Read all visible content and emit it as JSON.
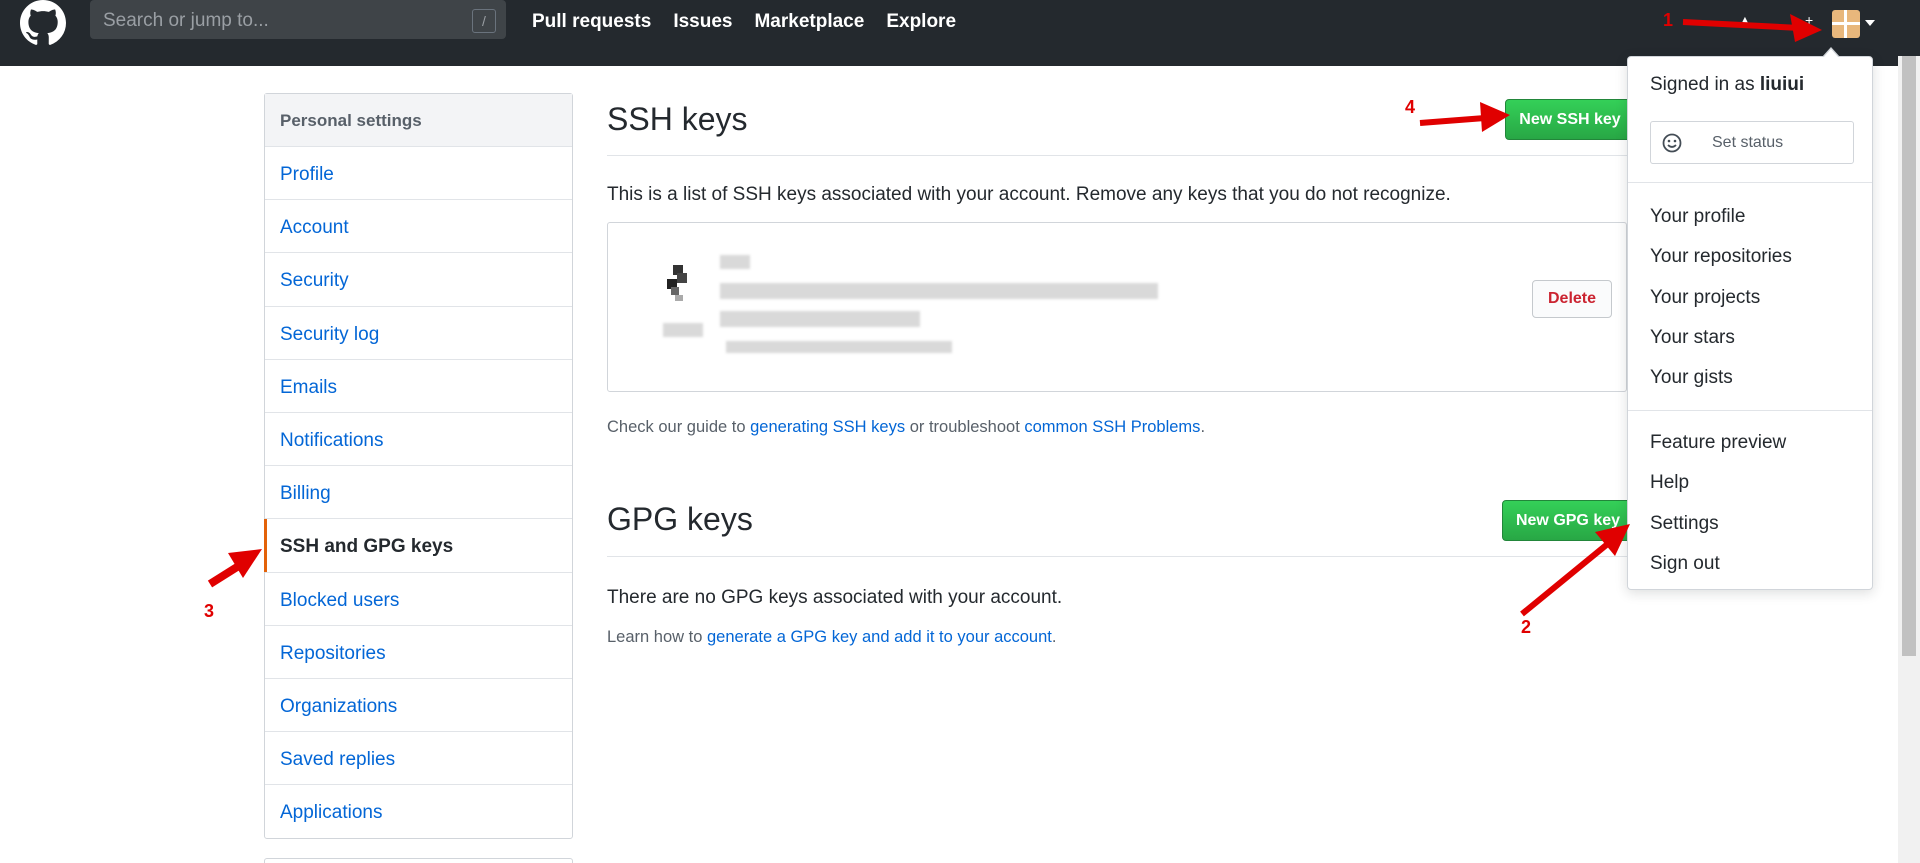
{
  "header": {
    "search_placeholder": "Search or jump to...",
    "search_shortcut": "/",
    "nav": [
      "Pull requests",
      "Issues",
      "Marketplace",
      "Explore"
    ]
  },
  "sidebar": {
    "heading": "Personal settings",
    "items": [
      {
        "label": "Profile"
      },
      {
        "label": "Account"
      },
      {
        "label": "Security"
      },
      {
        "label": "Security log"
      },
      {
        "label": "Emails"
      },
      {
        "label": "Notifications"
      },
      {
        "label": "Billing"
      },
      {
        "label": "SSH and GPG keys",
        "active": true
      },
      {
        "label": "Blocked users"
      },
      {
        "label": "Repositories"
      },
      {
        "label": "Organizations"
      },
      {
        "label": "Saved replies"
      },
      {
        "label": "Applications"
      }
    ]
  },
  "ssh": {
    "title": "SSH keys",
    "new_button": "New SSH key",
    "description_pre": "This is a list",
    "description_post": " of SSH keys associated with your account. Remove any keys that you do not recognize.",
    "delete_button": "Delete",
    "guide_pre": "Check",
    "guide_mid1": " our guide to ",
    "guide_link1": "generating SSH keys",
    "guide_mid2": " or troubleshoot ",
    "guide_link2": "common SSH Problems",
    "guide_end": "."
  },
  "gpg": {
    "title": "GPG keys",
    "new_button": "New GPG key",
    "none_text": "There are no GPG keys associated with your account.",
    "learn_pre": "Learn how to ",
    "learn_link": "generate a GPG key and add it to your account",
    "learn_end": "."
  },
  "dropdown": {
    "signed_in_as": "Signed in as",
    "username": "liuiui",
    "set_status": "Set status",
    "group1": [
      "Your profile",
      "Your repositories",
      "Your projects",
      "Your stars",
      "Your gists"
    ],
    "group2": [
      "Feature preview",
      "Help",
      "Settings",
      "Sign out"
    ]
  },
  "annotations": {
    "color": "#e00000",
    "labels": [
      "1",
      "2",
      "3",
      "4"
    ]
  }
}
